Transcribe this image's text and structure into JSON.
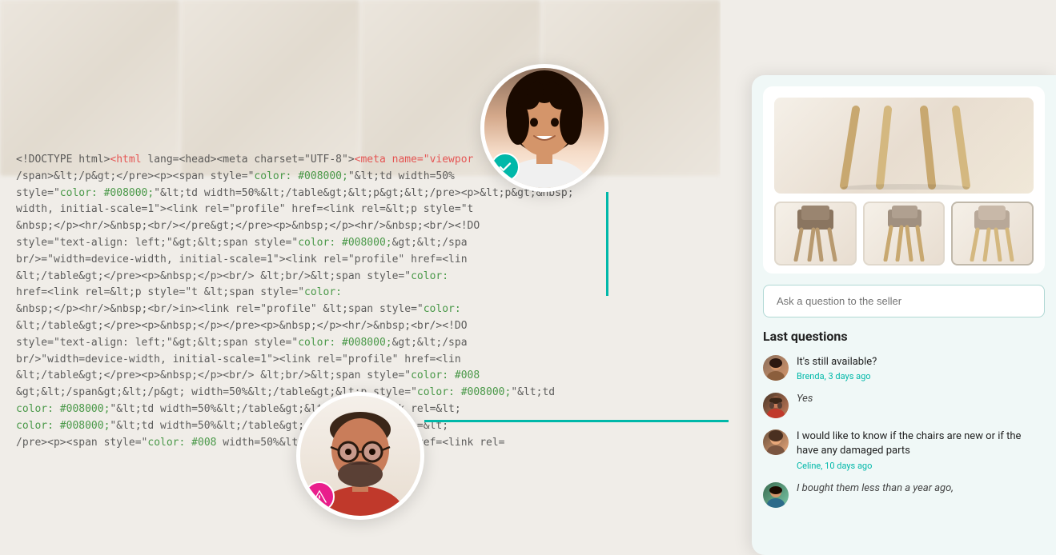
{
  "background": {
    "code_lines": [
      "<!DOCTYPE html><html lang=<head><meta charset=\"UTF-8\"><meta name=\"viewpor",
      "/span>&lt;/p&gt;</pre><p><span style=\"color: #008000;\"&lt;td width=50%",
      "style=\"color: #008000;\"&lt;td width=50%&lt;/table&gt;&lt;p&gt;&lt;/pre><p>&lt;p&gt;&nbsp;",
      "width, initial-scale=1\"><link rel=\"profile\" href=<link rel=&lt;p style=\"t",
      "&nbsp;</p><hr/>&nbsp;<br/></pre&gt;</pre><p>&nbsp;</p><hr/>&nbsp;<br/><!DO",
      "style=\"text-align: left;\"&gt;&lt;span style=\"color: #008000;&gt;&lt;/spa",
      "br/>=\"width=device-width, initial-scale=1\"><link rel=\"profile\" href=<lin",
      "&lt;/table&gt;</pre><p>&nbsp;</p><br/> &lt;br/>&lt;span style=\"color:",
      "href=<link rel=&lt;p style=\"t                                  &lt;span style=\"color:",
      "&nbsp;</p><hr/>&nbsp;<br/>in&gt;<link rel=\"profile\"         &lt;span style=\"color:",
      "&lt;/table&gt;</pre><p>&nbsp;</p></pre><p>&nbsp;</p><hr/>&nbsp;<br/><!DO",
      "style=\"text-align: left;\"&gt;&lt;span style=\"color: #008000;&gt;&lt;/spa",
      "br/>\"width=device-width, initial-scale=1\"><link rel=\"profile\" href=<lin",
      "&lt;/table&gt;</pre><p>&nbsp;</p><br/> &lt;br/>&lt;span style=\"color: #008",
      "&gt;&lt;/span&gt;&lt;/p&gt; width=50%&lt;/table&gt;&lt;p style=\"color: #008000;\"&lt;td",
      "color: #008000;\"&lt;td width=50%&lt;/table&gt;&lt;p href=<link rel=&lt;",
      "color: #008000;\"&lt;td width=50%&lt;/table&gt;</p href=<link rel=&lt;",
      "/pre><p><span style=\"color: #008  width=50%&lt;/table&gt;&lt;/p href=<link rel="
    ],
    "code_red_words": [
      "color: #008000;",
      "#008000;\"&lt;td",
      "#008000;\"&lt;td"
    ],
    "blurred_blocks": 4
  },
  "seller": {
    "checkmark_label": "✓",
    "connector_visible": true
  },
  "buyer": {
    "warning_label": "!",
    "connector_visible": true
  },
  "panel": {
    "product_images": {
      "thumbnails": [
        {
          "id": "thumb-1",
          "alt": "Chair front view"
        },
        {
          "id": "thumb-2",
          "alt": "Chair side view"
        },
        {
          "id": "thumb-3",
          "alt": "Chair angle view"
        }
      ]
    },
    "question_input": {
      "placeholder": "Ask a question to the seller",
      "value": ""
    },
    "last_questions_title": "Last questions",
    "questions": [
      {
        "id": "q1",
        "text": "It's still available?",
        "author": "Brenda",
        "time": "3 days ago",
        "meta": "Brenda, 3 days ago",
        "answer": null
      },
      {
        "id": "q2",
        "text": "Yes",
        "author": "",
        "time": "",
        "meta": "",
        "answer": null,
        "is_answer": true
      },
      {
        "id": "q3",
        "text": "I would like to know if the chairs are new or if the have any damaged parts",
        "author": "Celine",
        "time": "10 days ago",
        "meta": "Celine, 10 days ago",
        "answer": null
      },
      {
        "id": "q4",
        "text": "I bought them less than a year ago,",
        "author": "",
        "time": "",
        "meta": "",
        "answer": null,
        "is_answer": true
      }
    ]
  },
  "detection": {
    "ask_question_label": "Ask & question to the seller"
  }
}
